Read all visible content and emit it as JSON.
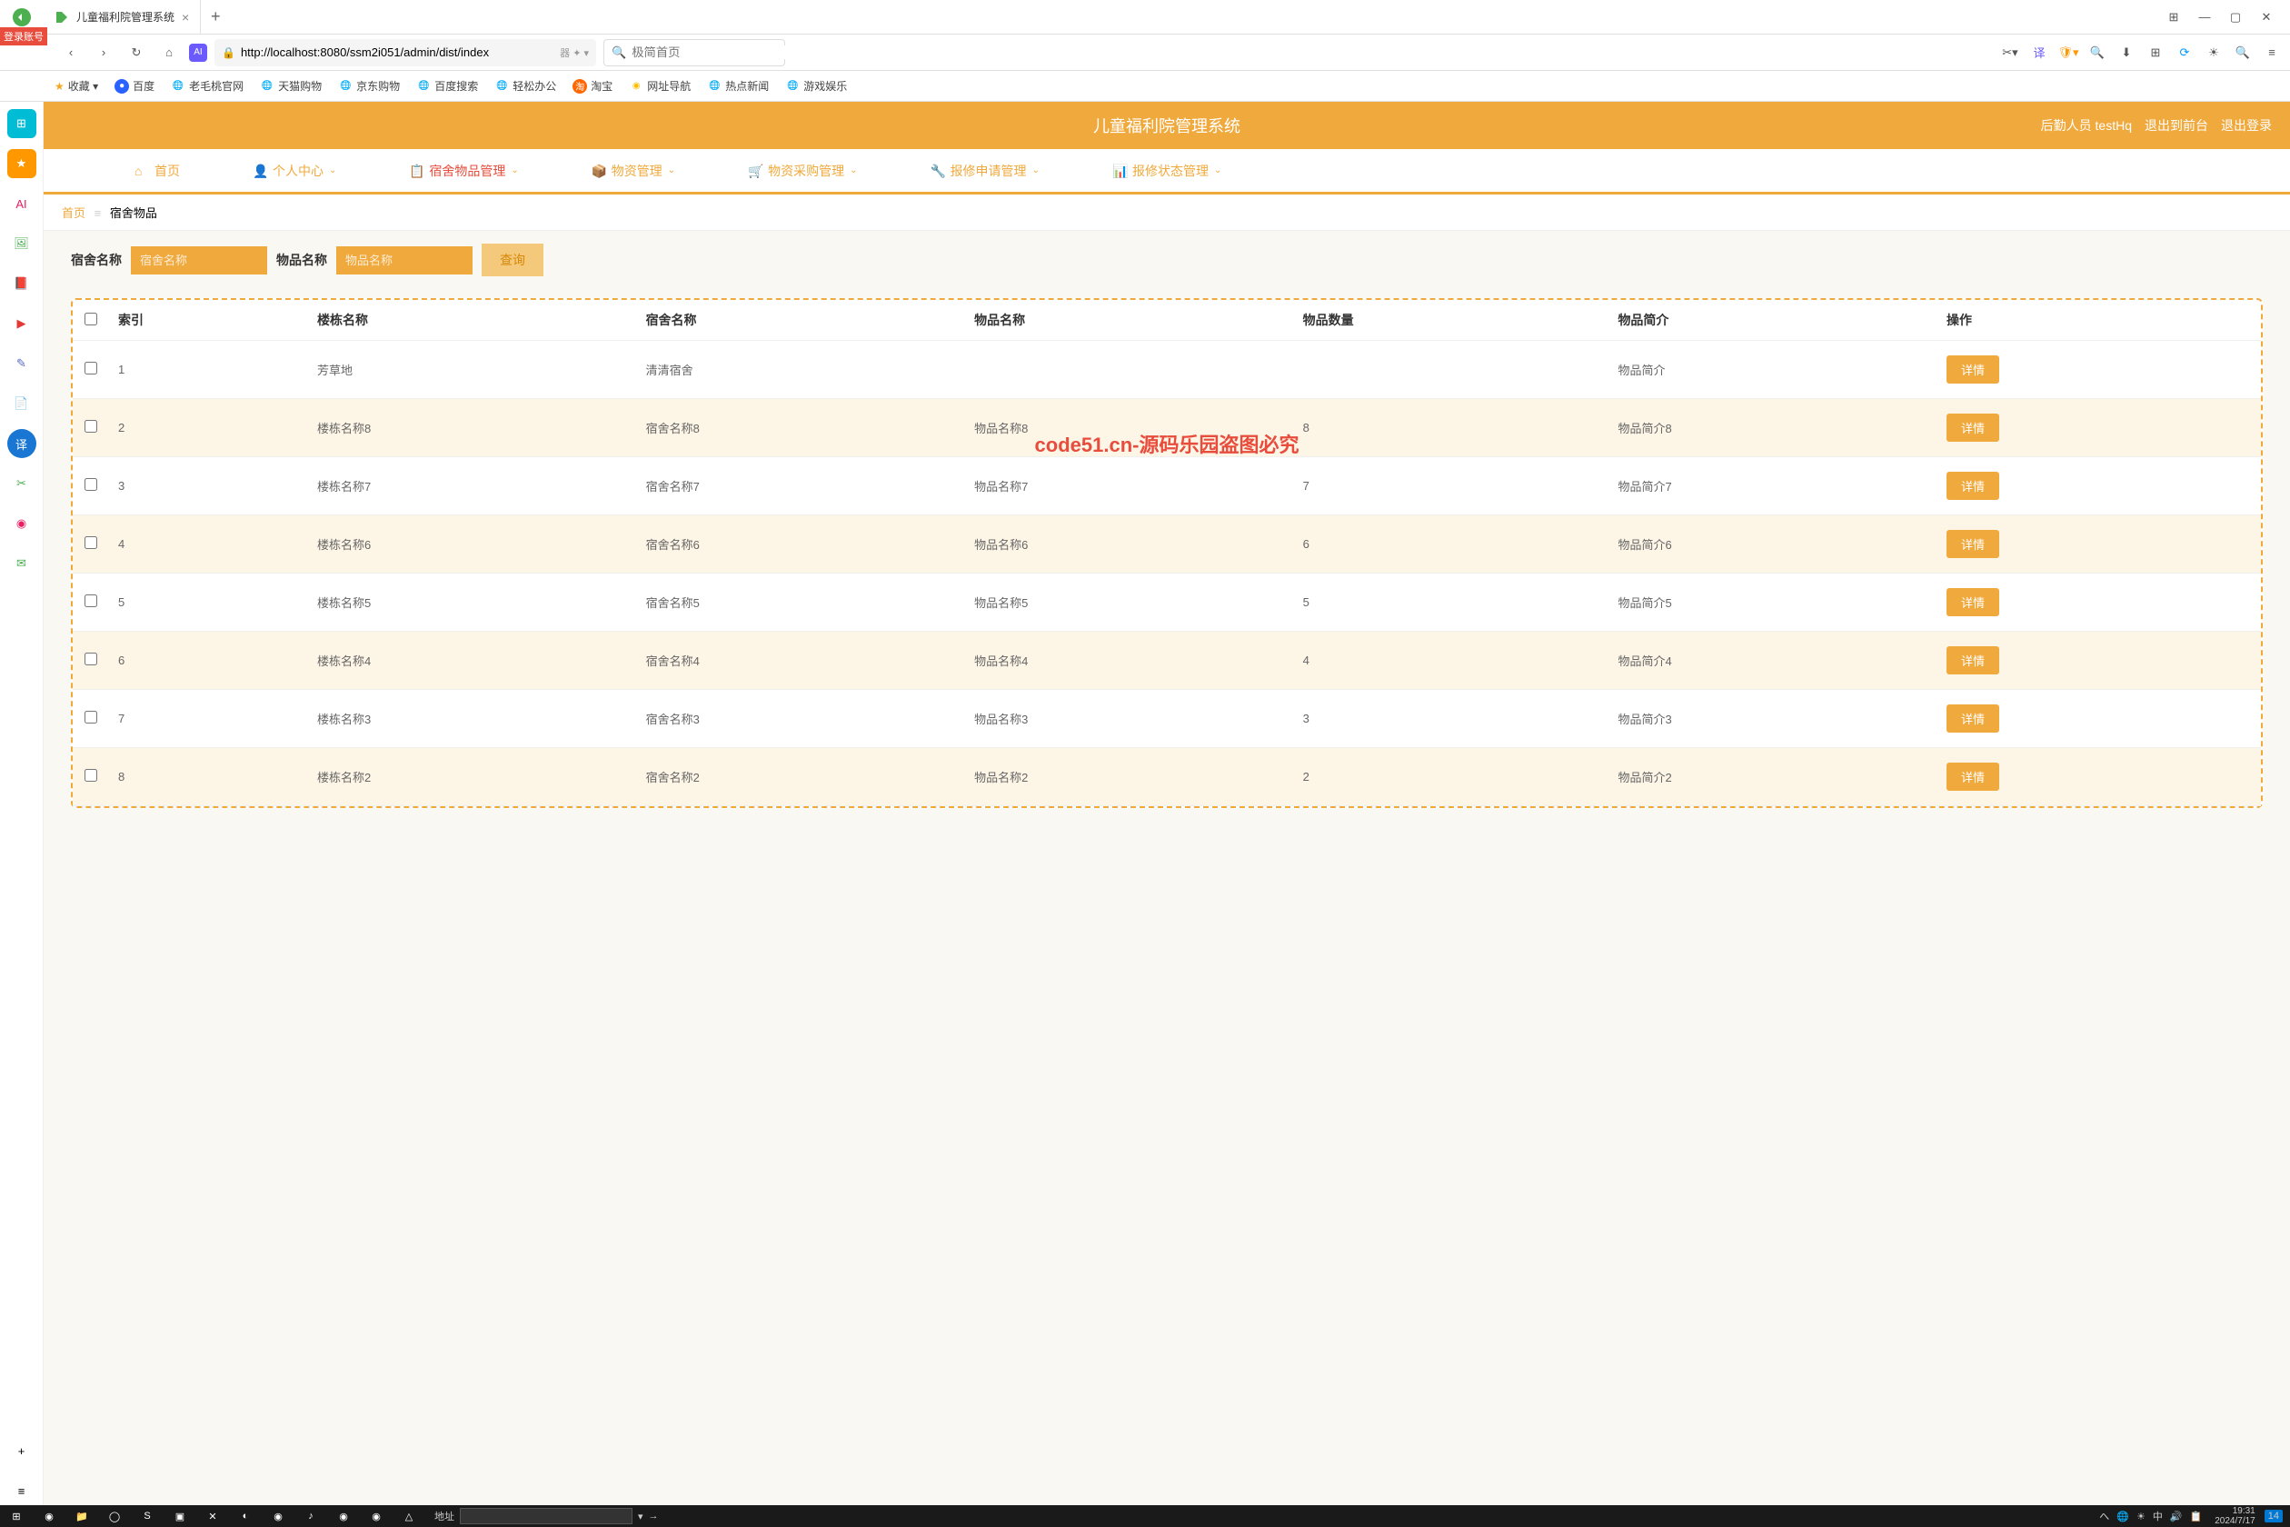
{
  "browser": {
    "tab_title": "儿童福利院管理系统",
    "new_tab": "+",
    "login_badge": "登录账号",
    "url": "http://localhost:8080/ssm2i051/admin/dist/index",
    "url_suffix": "器 ✦ ▾",
    "search_placeholder": "极简首页",
    "window_controls": {
      "ext": "⊞",
      "min": "—",
      "max": "▢",
      "close": "✕"
    }
  },
  "bookmarks": [
    "收藏 ▾",
    "百度",
    "老毛桃官网",
    "天猫购物",
    "京东购物",
    "百度搜索",
    "轻松办公",
    "淘宝",
    "网址导航",
    "热点新闻",
    "游戏娱乐"
  ],
  "rail_icons": [
    "⊞",
    "★",
    "AI",
    "🖼",
    "📕",
    "▶",
    "✎",
    "📄",
    "译",
    "✂",
    "◉",
    "✉",
    "+",
    "≡"
  ],
  "header": {
    "title": "儿童福利院管理系统",
    "user_label": "后勤人员 testHq",
    "logout_front": "退出到前台",
    "logout": "退出登录"
  },
  "nav": [
    {
      "icon": "home",
      "label": "首页",
      "caret": false
    },
    {
      "icon": "user",
      "label": "个人中心",
      "caret": true
    },
    {
      "icon": "file",
      "label": "宿舍物品管理",
      "caret": true,
      "active": true
    },
    {
      "icon": "box",
      "label": "物资管理",
      "caret": true
    },
    {
      "icon": "cart",
      "label": "物资采购管理",
      "caret": true
    },
    {
      "icon": "wrench",
      "label": "报修申请管理",
      "caret": true
    },
    {
      "icon": "status",
      "label": "报修状态管理",
      "caret": true
    }
  ],
  "breadcrumb": {
    "home": "首页",
    "sep": "≡",
    "current": "宿舍物品"
  },
  "search": {
    "label1": "宿舍名称",
    "placeholder1": "宿舍名称",
    "label2": "物品名称",
    "placeholder2": "物品名称",
    "button": "查询"
  },
  "table": {
    "headers": [
      "",
      "索引",
      "楼栋名称",
      "宿舍名称",
      "物品名称",
      "物品数量",
      "物品简介",
      "操作"
    ],
    "action_label": "详情",
    "rows": [
      {
        "idx": "1",
        "bldg": "芳草地",
        "dorm": "清清宿舍",
        "item": "",
        "qty": "",
        "desc": "物品简介"
      },
      {
        "idx": "2",
        "bldg": "楼栋名称8",
        "dorm": "宿舍名称8",
        "item": "物品名称8",
        "qty": "8",
        "desc": "物品简介8"
      },
      {
        "idx": "3",
        "bldg": "楼栋名称7",
        "dorm": "宿舍名称7",
        "item": "物品名称7",
        "qty": "7",
        "desc": "物品简介7"
      },
      {
        "idx": "4",
        "bldg": "楼栋名称6",
        "dorm": "宿舍名称6",
        "item": "物品名称6",
        "qty": "6",
        "desc": "物品简介6"
      },
      {
        "idx": "5",
        "bldg": "楼栋名称5",
        "dorm": "宿舍名称5",
        "item": "物品名称5",
        "qty": "5",
        "desc": "物品简介5"
      },
      {
        "idx": "6",
        "bldg": "楼栋名称4",
        "dorm": "宿舍名称4",
        "item": "物品名称4",
        "qty": "4",
        "desc": "物品简介4"
      },
      {
        "idx": "7",
        "bldg": "楼栋名称3",
        "dorm": "宿舍名称3",
        "item": "物品名称3",
        "qty": "3",
        "desc": "物品简介3"
      },
      {
        "idx": "8",
        "bldg": "楼栋名称2",
        "dorm": "宿舍名称2",
        "item": "物品名称2",
        "qty": "2",
        "desc": "物品简介2"
      }
    ]
  },
  "watermark": "code51.cn-源码乐园盗图必究",
  "taskbar": {
    "addr_label": "地址",
    "icons": [
      "⊞",
      "◉",
      "📁",
      "◯",
      "S",
      "▣",
      "✕",
      "◐",
      "◉",
      "♪",
      "◉",
      "◉",
      "△"
    ],
    "tray": [
      "へ",
      "🌐",
      "☀",
      "中",
      "🔊",
      "📋"
    ],
    "time": "19:31",
    "date": "2024/7/17",
    "notif": "14"
  }
}
